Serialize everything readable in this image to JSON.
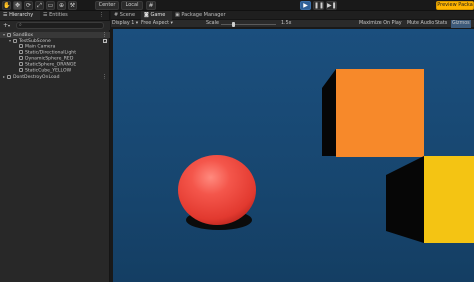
{
  "toolbar": {
    "pivot_label": "Center",
    "space_label": "Local",
    "preview_label": "Preview Packa"
  },
  "hierarchy": {
    "tab_label": "Hierarchy",
    "entities_tab_label": "Entities",
    "add_label": "+",
    "items": [
      {
        "label": "SandBox"
      },
      {
        "label": "TestSubScene"
      },
      {
        "label": "Main Camera"
      },
      {
        "label": "Static/DirectionalLight"
      },
      {
        "label": "DynamicSphere_RED"
      },
      {
        "label": "StaticSphere_ORANGE"
      },
      {
        "label": "StaticCube_YELLOW"
      },
      {
        "label": "DontDestroyOnLoad"
      }
    ]
  },
  "game_view": {
    "tabs": [
      {
        "label": "Scene"
      },
      {
        "label": "Game"
      },
      {
        "label": "Package Manager"
      }
    ],
    "display": "Display 1",
    "aspect": "Free Aspect",
    "scale_label": "Scale",
    "scale_value": "1.5x",
    "maximize_label": "Maximize On Play",
    "mute_label": "Mute Audio",
    "stats_label": "Stats",
    "gizmos_label": "Gizmos"
  },
  "colors": {
    "sky": "#1b4f7e",
    "sphere_red": "#e8413a",
    "cube_orange": "#f7892a",
    "cube_yellow": "#f4c413",
    "accent_play": "#2f5f96"
  }
}
